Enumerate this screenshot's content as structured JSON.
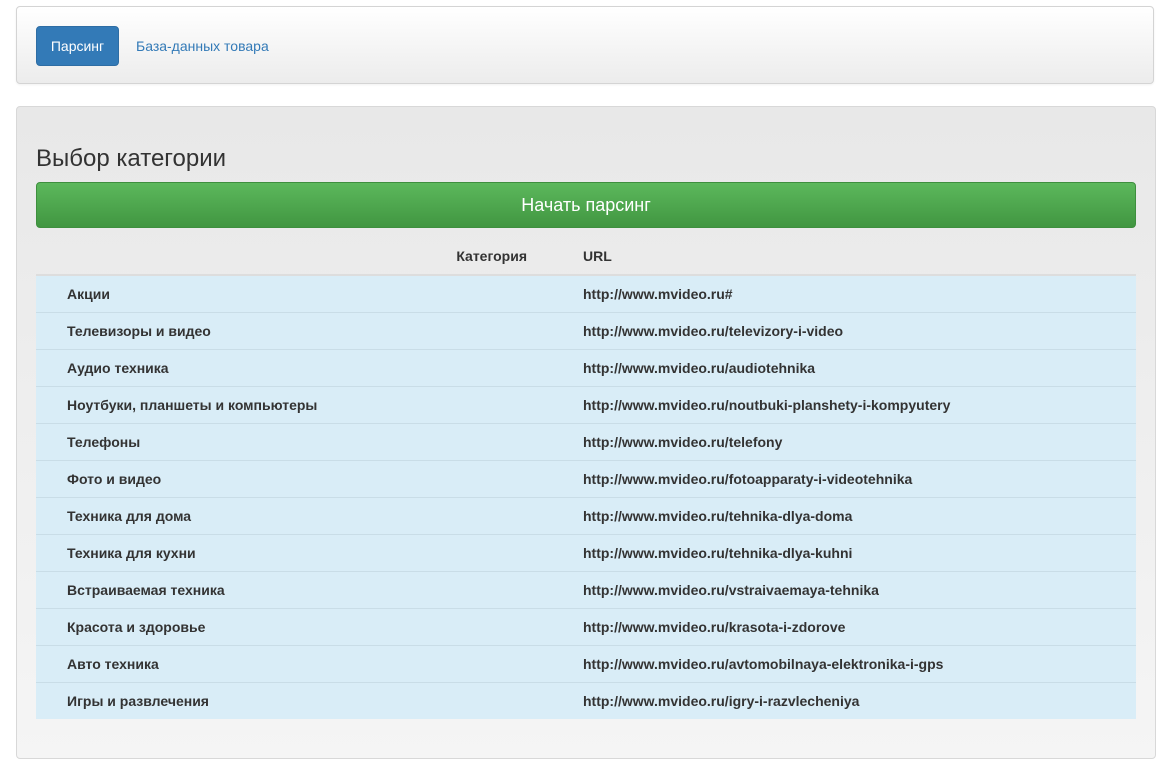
{
  "nav": {
    "active_button": "Парсинг",
    "link": "База-данных товара"
  },
  "panel": {
    "title": "Выбор категории",
    "start_button": "Начать парсинг"
  },
  "table": {
    "headers": [
      "Категория",
      "URL"
    ],
    "rows": [
      {
        "category": "Акции",
        "url": "http://www.mvideo.ru#"
      },
      {
        "category": "Телевизоры и видео",
        "url": "http://www.mvideo.ru/televizory-i-video"
      },
      {
        "category": "Аудио техника",
        "url": "http://www.mvideo.ru/audiotehnika"
      },
      {
        "category": "Ноутбуки, планшеты и компьютеры",
        "url": "http://www.mvideo.ru/noutbuki-planshety-i-kompyutery"
      },
      {
        "category": "Телефоны",
        "url": "http://www.mvideo.ru/telefony"
      },
      {
        "category": "Фото и видео",
        "url": "http://www.mvideo.ru/fotoapparaty-i-videotehnika"
      },
      {
        "category": "Техника для дома",
        "url": "http://www.mvideo.ru/tehnika-dlya-doma"
      },
      {
        "category": "Техника для кухни",
        "url": "http://www.mvideo.ru/tehnika-dlya-kuhni"
      },
      {
        "category": "Встраиваемая техника",
        "url": "http://www.mvideo.ru/vstraivaemaya-tehnika"
      },
      {
        "category": "Красота и здоровье",
        "url": "http://www.mvideo.ru/krasota-i-zdorove"
      },
      {
        "category": "Авто техника",
        "url": "http://www.mvideo.ru/avtomobilnaya-elektronika-i-gps"
      },
      {
        "category": "Игры и развлечения",
        "url": "http://www.mvideo.ru/igry-i-razvlecheniya"
      }
    ]
  },
  "colors": {
    "primary": "#337ab7",
    "success": "#5cb85c",
    "row_info": "#d9edf7"
  }
}
